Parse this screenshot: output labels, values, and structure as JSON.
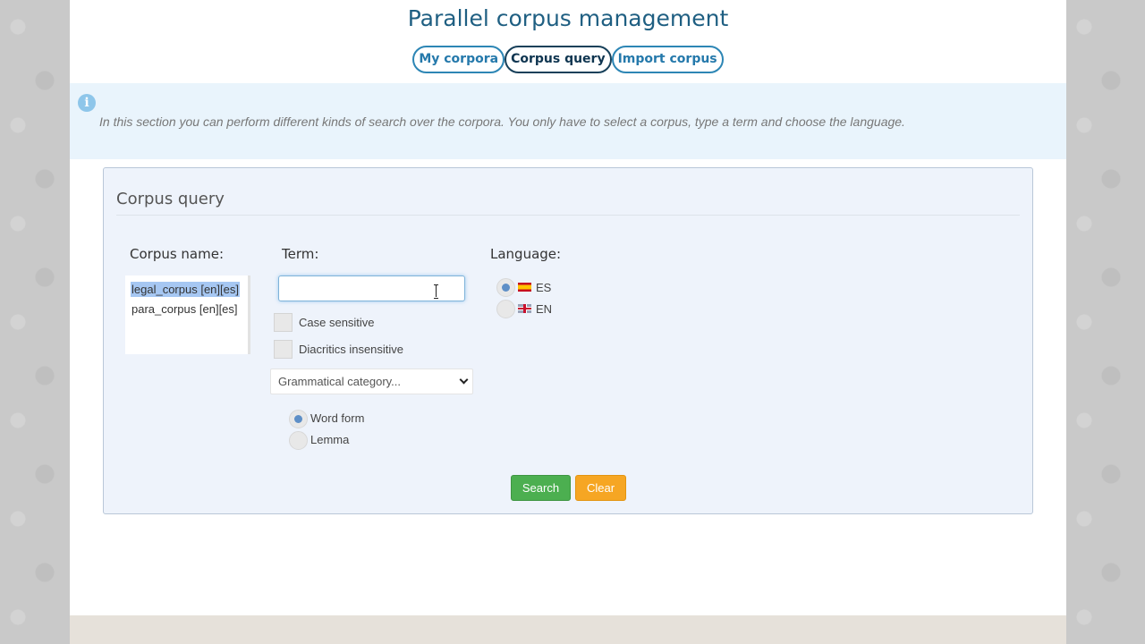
{
  "header": {
    "title": "Parallel corpus management"
  },
  "tabs": [
    {
      "label": "My corpora",
      "active": false
    },
    {
      "label": "Corpus query",
      "active": true
    },
    {
      "label": "Import corpus",
      "active": false
    }
  ],
  "info": {
    "icon": "info-icon",
    "text": "In this section you can perform different kinds of search over the corpora. You only have to select a corpus, type a term and choose the language."
  },
  "panel": {
    "title": "Corpus query",
    "corpus_label": "Corpus name:",
    "corpora": [
      {
        "label": "legal_corpus [en][es]",
        "selected": true
      },
      {
        "label": "para_corpus [en][es]",
        "selected": false
      }
    ],
    "term_label": "Term:",
    "term_value": "",
    "case_sensitive_label": "Case sensitive",
    "diacritics_label": "Diacritics insensitive",
    "grammatical_select": "Grammatical category...",
    "word_form_label": "Word form",
    "lemma_label": "Lemma",
    "language_label": "Language:",
    "languages": [
      {
        "code": "ES",
        "flag": "spain-flag-icon",
        "selected": true
      },
      {
        "code": "EN",
        "flag": "uk-flag-icon",
        "selected": false
      }
    ],
    "search_label": "Search",
    "clear_label": "Clear"
  },
  "colors": {
    "title": "#1f5f82",
    "tab_border": "#2d86b5",
    "info_bg": "#e9f4fc",
    "panel_bg": "#eef3fb",
    "search_btn": "#4caf50",
    "clear_btn": "#f6a623"
  }
}
